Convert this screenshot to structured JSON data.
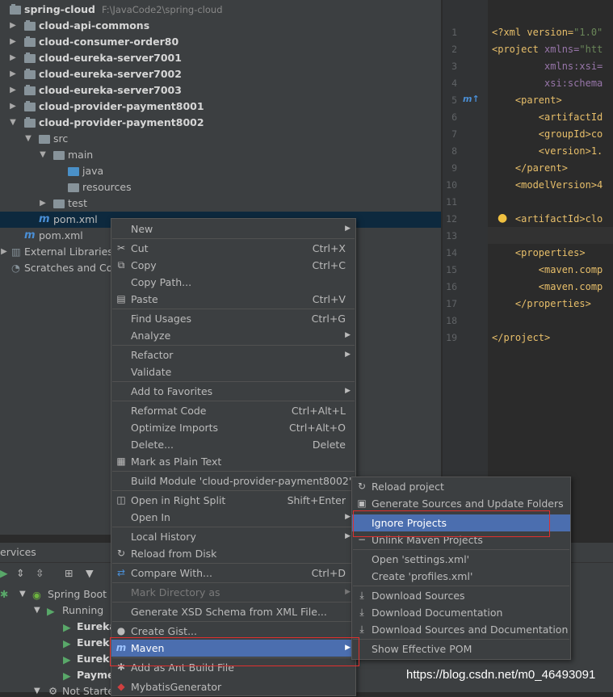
{
  "project": {
    "root_name": "spring-cloud",
    "root_path": "F:\\JavaCode2\\spring-cloud",
    "modules": [
      "cloud-api-commons",
      "cloud-consumer-order80",
      "cloud-eureka-server7001",
      "cloud-eureka-server7002",
      "cloud-eureka-server7003",
      "cloud-provider-payment8001",
      "cloud-provider-payment8002"
    ],
    "src": "src",
    "main": "main",
    "java": "java",
    "resources": "resources",
    "test": "test",
    "pom_module": "pom.xml",
    "pom_root": "pom.xml",
    "external_libraries": "External Libraries",
    "scratches": "Scratches and Con"
  },
  "editor": {
    "line_numbers": [
      "1",
      "2",
      "3",
      "4",
      "5",
      "6",
      "7",
      "8",
      "9",
      "10",
      "11",
      "12",
      "13",
      "14",
      "15",
      "16",
      "17",
      "18",
      "19"
    ],
    "lines": [
      {
        "pre": "<?xml version=",
        "val": "\"1.0\""
      },
      {
        "pre": "<project ",
        "attr": "xmlns=",
        "val": "\"htt"
      },
      {
        "pre": "         ",
        "attr": "xmlns:xsi=",
        "val": ""
      },
      {
        "pre": "         ",
        "attr": "xsi:schema",
        "val": ""
      },
      {
        "pre": "    <parent>"
      },
      {
        "pre": "        <artifactId"
      },
      {
        "pre": "        <groupId>co"
      },
      {
        "pre": "        <version>1."
      },
      {
        "pre": "    </parent>"
      },
      {
        "pre": "    <modelVersion>4"
      },
      {
        "pre": ""
      },
      {
        "pre": "    <artifactId>clo"
      },
      {
        "pre": ""
      },
      {
        "pre": "    <properties>"
      },
      {
        "pre": "        <maven.comp"
      },
      {
        "pre": "        <maven.comp"
      },
      {
        "pre": "    </properties>"
      },
      {
        "pre": ""
      },
      {
        "pre": "</project>"
      }
    ]
  },
  "services": {
    "title": "ervices",
    "spring_boot": "Spring Boot",
    "running": "Running",
    "apps": [
      "Eureka",
      "Eureka",
      "Eureka",
      "Payme"
    ],
    "not_started": "Not Starte"
  },
  "context_menu": {
    "new": "New",
    "cut": "Cut",
    "cut_key": "Ctrl+X",
    "copy": "Copy",
    "copy_key": "Ctrl+C",
    "copy_path": "Copy Path...",
    "paste": "Paste",
    "paste_key": "Ctrl+V",
    "find_usages": "Find Usages",
    "find_usages_key": "Ctrl+G",
    "analyze": "Analyze",
    "refactor": "Refactor",
    "validate": "Validate",
    "add_favorites": "Add to Favorites",
    "reformat": "Reformat Code",
    "reformat_key": "Ctrl+Alt+L",
    "optimize": "Optimize Imports",
    "optimize_key": "Ctrl+Alt+O",
    "delete": "Delete...",
    "delete_key": "Delete",
    "mark_plain": "Mark as Plain Text",
    "build_module": "Build Module 'cloud-provider-payment8002'",
    "open_right": "Open in Right Split",
    "open_right_key": "Shift+Enter",
    "open_in": "Open In",
    "local_history": "Local History",
    "reload_disk": "Reload from Disk",
    "compare_with": "Compare With...",
    "compare_with_key": "Ctrl+D",
    "mark_dir": "Mark Directory as",
    "gen_xsd": "Generate XSD Schema from XML File...",
    "create_gist": "Create Gist...",
    "maven": "Maven",
    "add_ant": "Add as Ant Build File",
    "mybatis": "MybatisGenerator"
  },
  "maven_menu": {
    "reload": "Reload project",
    "generate": "Generate Sources and Update Folders",
    "ignore": "Ignore Projects",
    "unlink": "Unlink Maven Projects",
    "open_settings": "Open 'settings.xml'",
    "create_profiles": "Create 'profiles.xml'",
    "download_sources": "Download Sources",
    "download_docs": "Download Documentation",
    "download_both": "Download Sources and Documentation",
    "show_pom": "Show Effective POM"
  },
  "watermark": "https://blog.csdn.net/m0_46493091",
  "colors": {
    "selection": "#4b6eaf",
    "highlight_box": "#e0302f",
    "panel": "#3c3f41",
    "editor": "#2b2b2b"
  }
}
